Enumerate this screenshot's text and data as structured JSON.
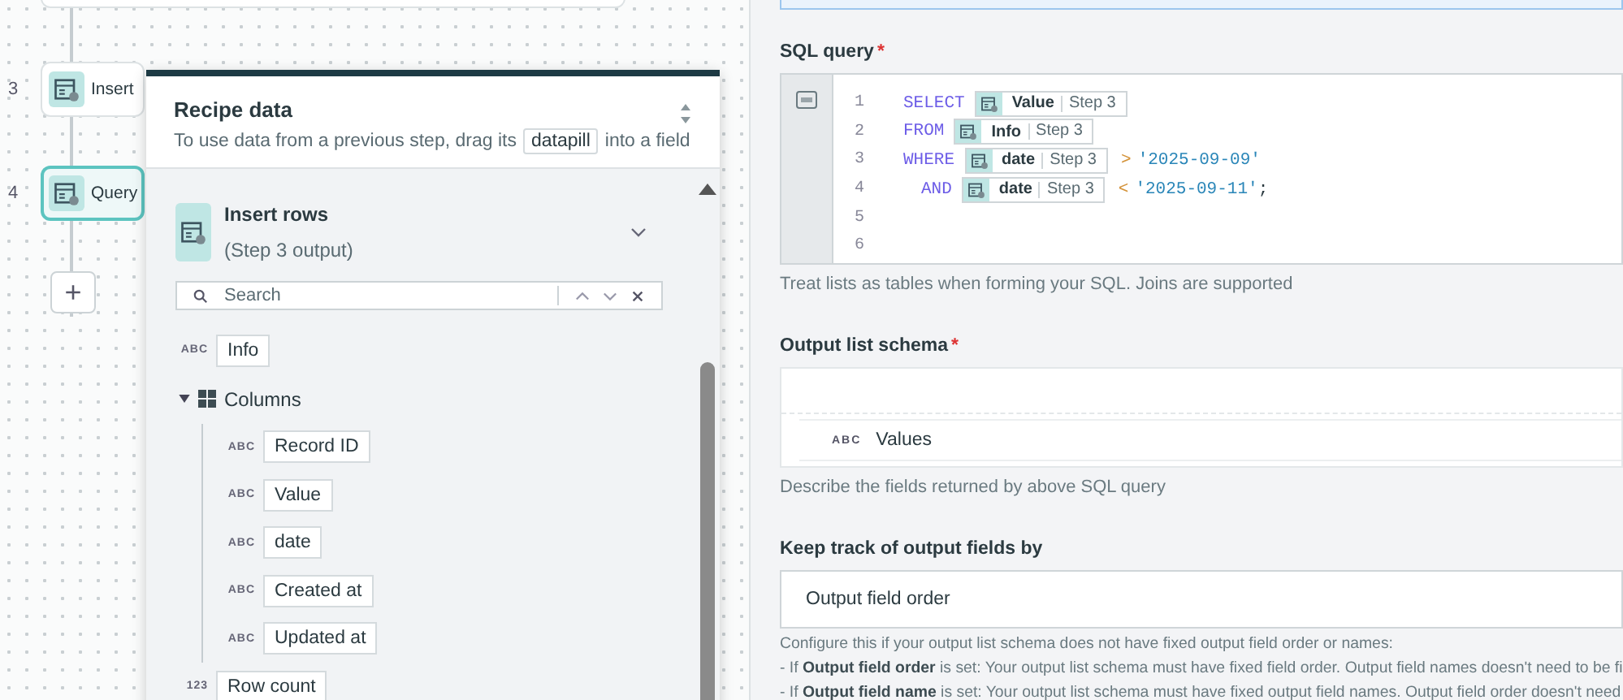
{
  "canvas": {
    "steps": [
      {
        "number": "3",
        "title": "Insert",
        "selected": false
      },
      {
        "number": "4",
        "title": "Query",
        "selected": true
      }
    ],
    "add_button": "+"
  },
  "recipe_data": {
    "title": "Recipe data",
    "subtitle_before": "To use data from a previous step, drag its",
    "pill": "datapill",
    "subtitle_after": "into a field",
    "source": {
      "title": "Insert rows",
      "subtitle": "(Step 3 output)",
      "expanded": true
    },
    "search": {
      "placeholder": "Search"
    },
    "tree": [
      {
        "kind": "field",
        "type_label": "ABC",
        "label": "Info"
      },
      {
        "kind": "group",
        "label": "Columns",
        "expanded": true,
        "children": [
          {
            "kind": "field",
            "type_label": "ABC",
            "label": "Record ID"
          },
          {
            "kind": "field",
            "type_label": "ABC",
            "label": "Value"
          },
          {
            "kind": "field",
            "type_label": "ABC",
            "label": "date"
          },
          {
            "kind": "field",
            "type_label": "ABC",
            "label": "Created at"
          },
          {
            "kind": "field",
            "type_label": "ABC",
            "label": "Updated at"
          }
        ]
      },
      {
        "kind": "field",
        "type_label": "123",
        "label": "Row count"
      }
    ]
  },
  "sql_query": {
    "label": "SQL query",
    "required_mark": "*",
    "lines": [
      {
        "number": "1",
        "indent": false,
        "tokens": [
          {
            "kind": "keyword",
            "text": "SELECT"
          },
          {
            "kind": "pill",
            "label": "Value",
            "step": "Step 3"
          }
        ]
      },
      {
        "number": "2",
        "indent": false,
        "tokens": [
          {
            "kind": "keyword",
            "text": "FROM"
          },
          {
            "kind": "pill",
            "label": "Info",
            "step": "Step 3"
          }
        ]
      },
      {
        "number": "3",
        "indent": false,
        "tokens": [
          {
            "kind": "keyword",
            "text": "WHERE"
          },
          {
            "kind": "pill",
            "label": "date",
            "step": "Step 3"
          },
          {
            "kind": "operator",
            "text": ">"
          },
          {
            "kind": "string",
            "text": "'2025-09-09'"
          }
        ]
      },
      {
        "number": "4",
        "indent": true,
        "tokens": [
          {
            "kind": "keyword",
            "text": "AND"
          },
          {
            "kind": "pill",
            "label": "date",
            "step": "Step 3"
          },
          {
            "kind": "operator",
            "text": "<"
          },
          {
            "kind": "string",
            "text": "'2025-09-11'"
          },
          {
            "kind": "punct",
            "text": ";"
          }
        ]
      },
      {
        "number": "5"
      },
      {
        "number": "6"
      }
    ],
    "hint": "Treat lists as tables when forming your SQL. Joins are supported"
  },
  "output_list_schema": {
    "label": "Output list schema",
    "required_mark": "*",
    "fields": [
      {
        "type_label": "ABC",
        "name": "Values"
      }
    ],
    "hint": "Describe the fields returned by above SQL query"
  },
  "keep_track": {
    "label": "Keep track of output fields by",
    "value": "Output field order",
    "hint_lines": [
      "Configure this if your output list schema does not have fixed output field order or names:",
      "- If **Output field order** is set: Your output list schema must have fixed field order. Output field names doesn't need to be fi",
      "- If **Output field name** is set: Your output list schema must have fixed output field names. Output field order doesn't need"
    ]
  }
}
